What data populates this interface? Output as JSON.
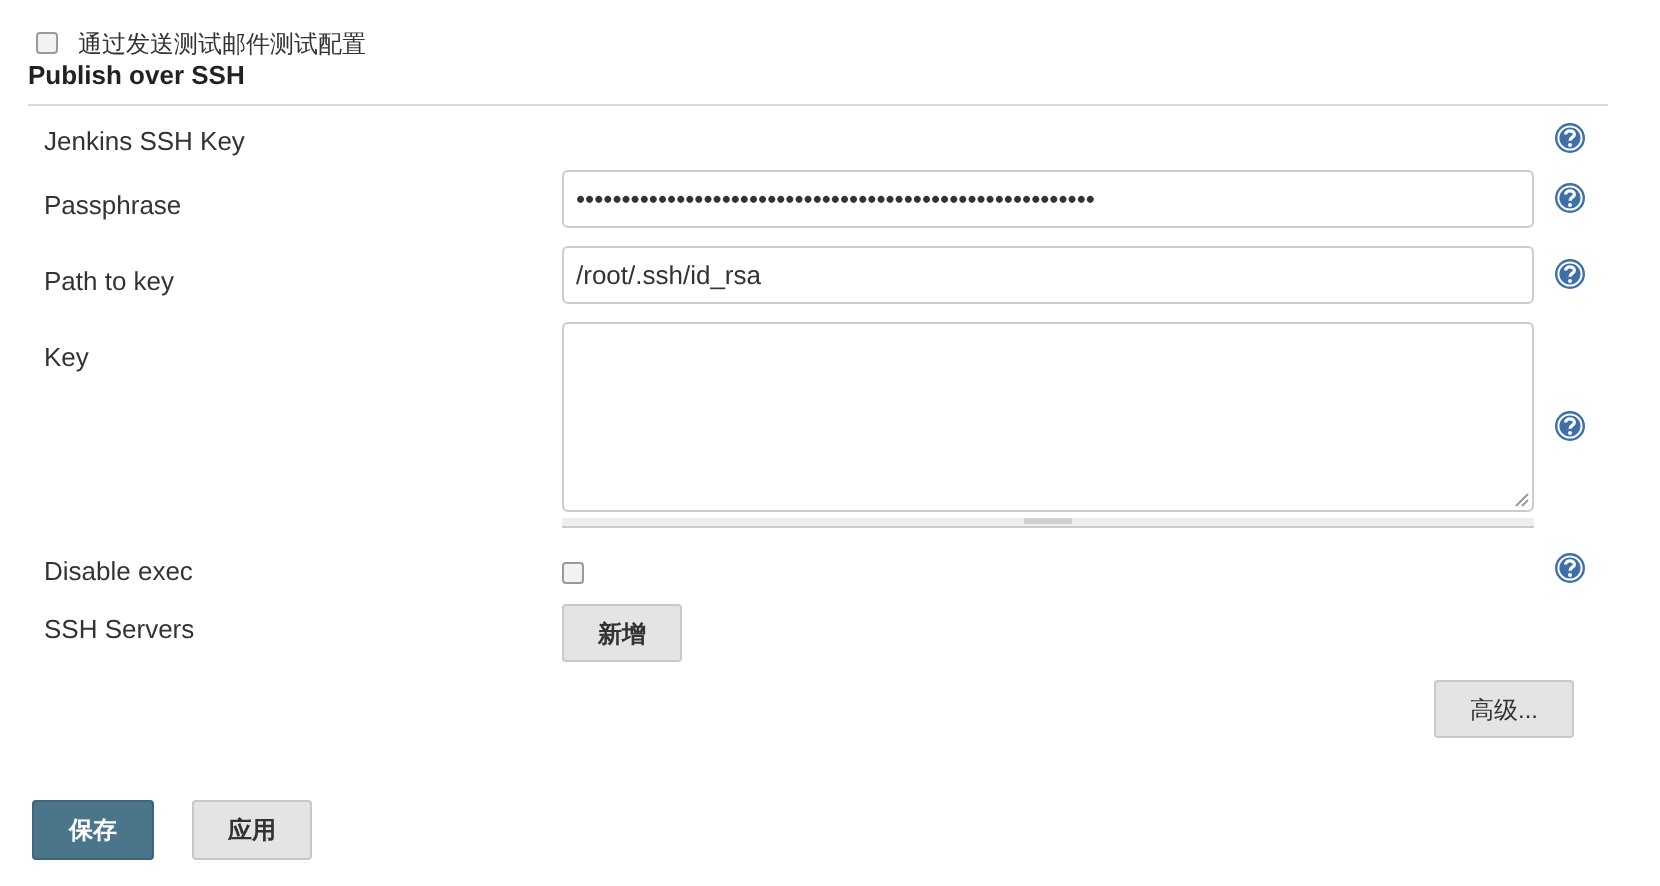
{
  "test_config": {
    "label": "通过发送测试邮件测试配置",
    "checked": false
  },
  "section": {
    "title": "Publish over SSH"
  },
  "fields": [
    {
      "kind": "none",
      "label": "Jenkins SSH Key",
      "help": true
    },
    {
      "kind": "text",
      "label": "Passphrase",
      "value": "•••••••••••••••••••••••••••••••••••••••••••••••••••••••••",
      "help": true
    },
    {
      "kind": "text",
      "label": "Path to key",
      "value": "/root/.ssh/id_rsa",
      "help": true
    },
    {
      "kind": "textarea",
      "label": "Key",
      "help": true
    },
    {
      "kind": "checkbox",
      "label": "Disable exec",
      "checked": false,
      "help": true
    },
    {
      "kind": "button",
      "label": "SSH Servers",
      "button": "新增",
      "help": false
    }
  ],
  "advanced_button": "高级...",
  "save_button": "保存",
  "apply_button": "应用"
}
